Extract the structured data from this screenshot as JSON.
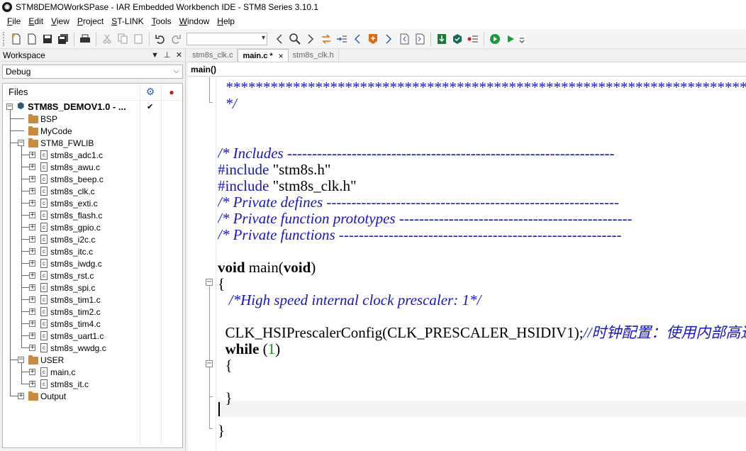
{
  "window": {
    "logo": "◉",
    "title": "STM8DEMOWorkSPase - IAR Embedded Workbench IDE - STM8 Series 3.10.1"
  },
  "menu": [
    {
      "u": "F",
      "rest": "ile"
    },
    {
      "u": "E",
      "rest": "dit"
    },
    {
      "u": "V",
      "rest": "iew"
    },
    {
      "u": "P",
      "rest": "roject"
    },
    {
      "u": "S",
      "rest": "T-LINK"
    },
    {
      "u": "T",
      "rest": "ools"
    },
    {
      "u": "W",
      "rest": "indow"
    },
    {
      "u": "H",
      "rest": "elp"
    }
  ],
  "workspace": {
    "title": "Workspace",
    "config": "Debug",
    "files_header": "Files",
    "project": "STM8S_DEMOV1.0 - ...",
    "project_check": "✔",
    "groups": {
      "bsp": "BSP",
      "mycode": "MyCode",
      "fwlib": "STM8_FWLIB",
      "user": "USER",
      "output": "Output"
    },
    "fwlib_files": [
      "stm8s_adc1.c",
      "stm8s_awu.c",
      "stm8s_beep.c",
      "stm8s_clk.c",
      "stm8s_exti.c",
      "stm8s_flash.c",
      "stm8s_gpio.c",
      "stm8s_i2c.c",
      "stm8s_itc.c",
      "stm8s_iwdg.c",
      "stm8s_rst.c",
      "stm8s_spi.c",
      "stm8s_tim1.c",
      "stm8s_tim2.c",
      "stm8s_tim4.c",
      "stm8s_uart1.c",
      "stm8s_wwdg.c"
    ],
    "user_files": [
      "main.c",
      "stm8s_it.c"
    ]
  },
  "editor": {
    "tabs": [
      {
        "label": "stm8s_clk.c",
        "active": false
      },
      {
        "label": "main.c *",
        "active": true
      },
      {
        "label": "stm8s_clk.h",
        "active": false
      }
    ],
    "tab_close": "×",
    "function": "main()",
    "code": {
      "stars": "  ******************************************************************************",
      "end_comment": "  */",
      "includes_c": "/* Includes ------------------------------------------------------------------",
      "inc1_kw": "#include ",
      "inc1_str": "\"stm8s.h\"",
      "inc2_kw": "#include ",
      "inc2_str": "\"stm8s_clk.h\"",
      "defines_c": "/* Private defines -----------------------------------------------------------",
      "proto_c": "/* Private function prototypes -----------------------------------------------",
      "funcs_c": "/* Private functions ---------------------------------------------------------",
      "main_void1": "void",
      "main_mid": " main(",
      "main_void2": "void",
      "main_end": ")",
      "brace_open": "{",
      "hs_comment": "   /*High speed internal clock prescaler: 1*/",
      "clk_call": "  CLK_HSIPrescalerConfig(CLK_PRESCALER_HSIDIV1);",
      "clk_comment": "//时钟配置：使用内部高速时钟",
      "while_kw": "  while",
      "while_paren_open": " (",
      "while_num": "1",
      "while_paren_close": ")",
      "while_open": "  {",
      "while_close": "  }",
      "brace_close": "}"
    }
  }
}
